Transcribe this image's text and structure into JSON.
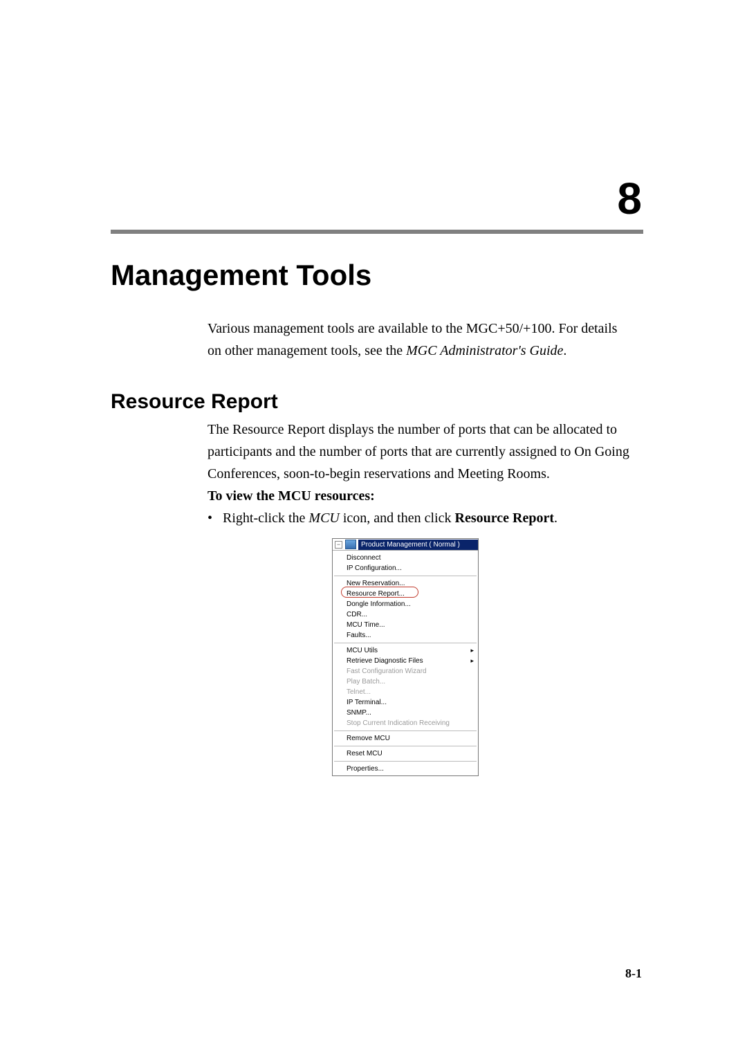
{
  "chapter": {
    "number": "8",
    "title": "Management Tools"
  },
  "intro": {
    "line1a": "Various management tools are available to the MGC+50/+100. For details",
    "line2a": "on other management tools, see the ",
    "line2b": "MGC Administrator's Guide",
    "line2c": "."
  },
  "section": {
    "title": "Resource Report"
  },
  "para": {
    "l1": "The Resource Report displays the number of ports that can be allocated to",
    "l2": "participants and the number of ports that are currently assigned to On Going",
    "l3": "Conferences, soon-to-begin reservations and Meeting Rooms."
  },
  "subhead": "To view the MCU resources:",
  "bullet": {
    "dot": "•",
    "a": "Right-click the ",
    "b": "MCU",
    "c": " icon, and then click ",
    "d": "Resource Report",
    "e": "."
  },
  "shot": {
    "tree_label": "Product Management   ( Normal )",
    "group1": [
      "Disconnect",
      "IP Configuration..."
    ],
    "group2": [
      "New Reservation...",
      "Resource Report...",
      "Dongle Information...",
      "CDR...",
      "MCU Time...",
      "Faults..."
    ],
    "group3": [
      {
        "label": "MCU Utils",
        "arrow": true,
        "disabled": false
      },
      {
        "label": "Retrieve Diagnostic Files",
        "arrow": true,
        "disabled": false
      },
      {
        "label": "Fast Configuration Wizard",
        "arrow": false,
        "disabled": true
      },
      {
        "label": "Play Batch...",
        "arrow": false,
        "disabled": true
      },
      {
        "label": "Telnet...",
        "arrow": false,
        "disabled": true
      },
      {
        "label": "IP Terminal...",
        "arrow": false,
        "disabled": false
      },
      {
        "label": "SNMP...",
        "arrow": false,
        "disabled": false
      },
      {
        "label": "Stop Current Indication Receiving",
        "arrow": false,
        "disabled": true
      }
    ],
    "group4": [
      "Remove MCU"
    ],
    "group5": [
      "Reset MCU"
    ],
    "group6": [
      "Properties..."
    ]
  },
  "page_number": "8-1"
}
